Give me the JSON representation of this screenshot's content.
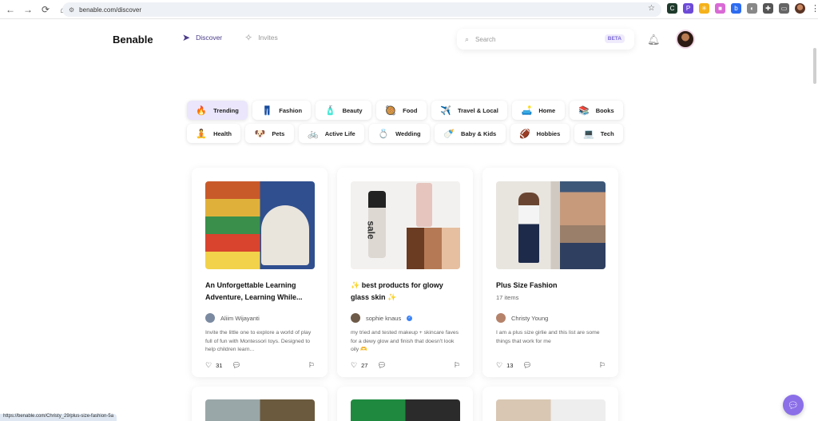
{
  "browser": {
    "url": "benable.com/discover",
    "status_url": "https://benable.com/Christy_29/plus-size-fashion-5a"
  },
  "header": {
    "brand": "Benable",
    "nav": [
      {
        "label": "Discover",
        "icon": "send-icon"
      },
      {
        "label": "Invites",
        "icon": "sparkle-icon"
      }
    ],
    "search_placeholder": "Search",
    "beta_label": "BETA"
  },
  "categories": {
    "row1": [
      {
        "label": "Trending",
        "icon": "🔥"
      },
      {
        "label": "Fashion",
        "icon": "👖"
      },
      {
        "label": "Beauty",
        "icon": "🧴"
      },
      {
        "label": "Food",
        "icon": "🥘"
      },
      {
        "label": "Travel & Local",
        "icon": "✈️"
      },
      {
        "label": "Home",
        "icon": "🛋️"
      },
      {
        "label": "Books",
        "icon": "📚"
      }
    ],
    "row2": [
      {
        "label": "Health",
        "icon": "🧘"
      },
      {
        "label": "Pets",
        "icon": "🐶"
      },
      {
        "label": "Active Life",
        "icon": "🚲"
      },
      {
        "label": "Wedding",
        "icon": "💍"
      },
      {
        "label": "Baby & Kids",
        "icon": "🍼"
      },
      {
        "label": "Hobbies",
        "icon": "🏈"
      },
      {
        "label": "Tech",
        "icon": "💻"
      }
    ]
  },
  "cards": [
    {
      "title": "An Unforgettable Learning Adventure, Learning While...",
      "author": "Aliim Wijayanti",
      "description": "Invite the little one to explore a world of play full of fun with Montessori toys. Designed to help children learn...",
      "likes": "31"
    },
    {
      "title": "✨ best products for glowy glass skin ✨",
      "author": "sophie knaus",
      "verified": "✓",
      "description": "my tried and tested makeup + skincare faves for a dewy glow and finish that doesn't look oily 🫶",
      "likes": "27",
      "img_text": "sale"
    },
    {
      "title": "Plus Size Fashion",
      "items": "17 items",
      "author": "Christy Young",
      "description": "I am a plus size girlie and this list are some things that work for me",
      "likes": "13"
    }
  ],
  "colors": {
    "accent": "#4c3d8a",
    "active_chip": "#ebe6fb",
    "fab": "#8b6fe8"
  }
}
